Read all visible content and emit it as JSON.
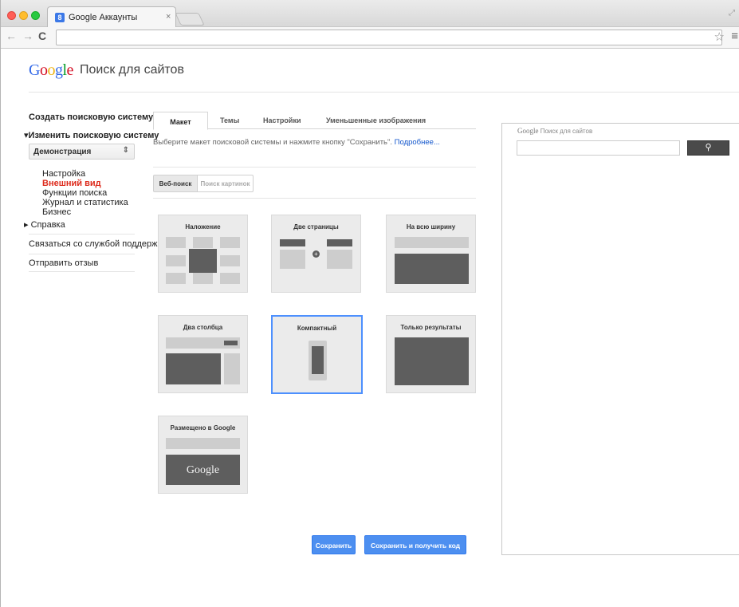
{
  "browser": {
    "tab_title": "Google Аккаунты",
    "tab_close": "×",
    "favicon": "8",
    "back": "←",
    "forward": "→",
    "reload": "C",
    "address": "",
    "star": "☆",
    "menu": "≡",
    "resize": "⤢"
  },
  "header": {
    "logo": {
      "G": "G",
      "o1": "o",
      "o2": "o",
      "g": "g",
      "l": "l",
      "e": "e"
    },
    "title": "Поиск для сайтов"
  },
  "sidebar": {
    "create": "Создать поисковую систему",
    "edit": "Изменить поисковую систему",
    "engine_select": "Демонстрация",
    "engine_select_arrow": "⇕",
    "items": [
      "Настройка",
      "Внешний вид",
      "Функции поиска",
      "Журнал и статистика",
      "Бизнес"
    ],
    "help": "Справка",
    "contact": "Связаться со службой поддержки",
    "feedback": "Отправить отзыв"
  },
  "tabs": [
    "Макет",
    "Темы",
    "Настройки",
    "Уменьшенные изображения"
  ],
  "instruction": {
    "text": "Выберите макет поисковой системы и нажмите кнопку \"Сохранить\".",
    "link": "Подробнее..."
  },
  "segment": {
    "web": "Веб-поиск",
    "images": "Поиск картинок"
  },
  "layouts": [
    {
      "label": "Наложение"
    },
    {
      "label": "Две страницы"
    },
    {
      "label": "На всю ширину"
    },
    {
      "label": "Два столбца"
    },
    {
      "label": "Компактный",
      "selected": true
    },
    {
      "label": "Только результаты"
    },
    {
      "label": "Размещено в Google",
      "inner_logo": "Google"
    }
  ],
  "buttons": {
    "save": "Сохранить",
    "save_code": "Сохранить и получить код"
  },
  "preview": {
    "brand": "Google",
    "brand_suffix": "Поиск для сайтов",
    "search_icon": "⚲",
    "search_value": ""
  },
  "colors": {
    "accent_blue": "#4d8ff0",
    "active_red": "#dd2a1b",
    "link_blue": "#1155cc",
    "dark_block": "#5e5e5e"
  }
}
